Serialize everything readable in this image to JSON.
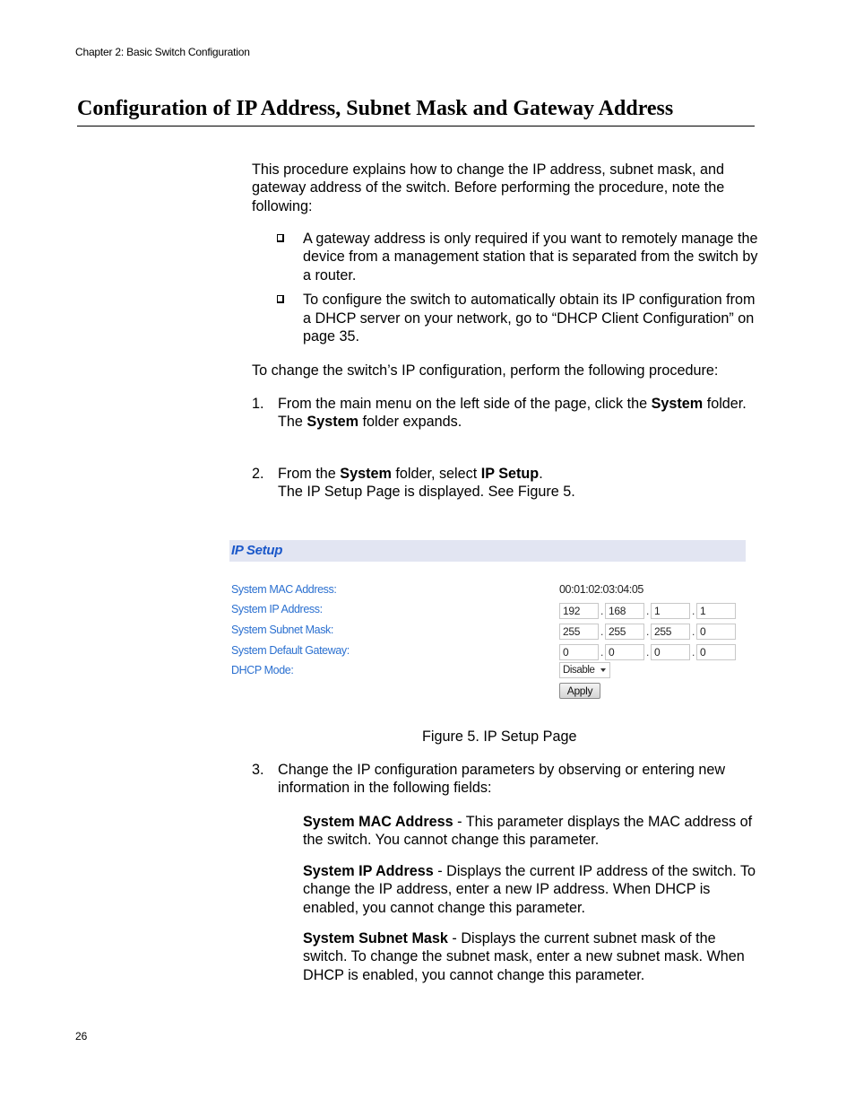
{
  "header": {
    "running_head": "Chapter 2: Basic Switch Configuration"
  },
  "title": "Configuration of IP Address, Subnet Mask and Gateway Address",
  "intro": "This procedure explains how to change the IP address, subnet mask, and gateway address of the switch. Before performing the procedure, note the following:",
  "bullets": [
    {
      "icon": "checkbox-bullet-icon",
      "text": "A gateway address is only required if you want to remotely manage the device from a management station that is separated from the switch by a router."
    },
    {
      "icon": "checkbox-bullet-icon",
      "text": "To configure the switch to automatically obtain its IP configuration from a DHCP server on your network, go to “DHCP Client Configuration” on page 35."
    }
  ],
  "lead": "To change the switch’s IP configuration, perform the following procedure:",
  "steps": {
    "s1": {
      "num": "1.",
      "a": "From the main menu on the left side of the page, click the ",
      "b": "System",
      "c": " folder.",
      "d": "The ",
      "e": "System",
      "f": " folder expands."
    },
    "s2": {
      "num": "2.",
      "a": "From the ",
      "b": "System",
      "c": " folder, select ",
      "d": "IP Setup",
      "e": ".",
      "f": "The IP Setup Page is displayed. See Figure 5."
    },
    "s3": {
      "num": "3.",
      "text": "Change the IP configuration parameters by observing or entering new information in the following fields:"
    }
  },
  "figure": {
    "header": "IP Setup",
    "fields": {
      "mac": {
        "label": "System MAC Address:",
        "value": "00:01:02:03:04:05"
      },
      "ip": {
        "label": "System IP Address:",
        "octets": [
          "192",
          "168",
          "1",
          "1"
        ]
      },
      "mask": {
        "label": "System Subnet Mask:",
        "octets": [
          "255",
          "255",
          "255",
          "0"
        ]
      },
      "gateway": {
        "label": "System Default Gateway:",
        "octets": [
          "0",
          "0",
          "0",
          "0"
        ]
      },
      "dhcp": {
        "label": "DHCP Mode:",
        "selected": "Disable"
      }
    },
    "octet_separator": ".",
    "apply_label": "Apply",
    "colors": {
      "header_bg": "#e2e5f2",
      "header_text": "#1a57c9",
      "label_text": "#2b70d0"
    },
    "caption": "Figure 5. IP Setup Page"
  },
  "params": [
    {
      "term": "System MAC Address",
      "desc": " - This parameter displays the MAC address of the switch. You cannot change this parameter."
    },
    {
      "term": "System IP Address",
      "desc": " - Displays the current IP address of the switch. To change the IP address, enter a new IP address. When DHCP is enabled, you cannot change this parameter."
    },
    {
      "term": "System Subnet Mask",
      "desc": " - Displays the current subnet mask of the switch. To change the subnet mask, enter a new subnet mask. When DHCP is enabled, you cannot change this parameter."
    }
  ],
  "footer": {
    "page_number": "26"
  }
}
